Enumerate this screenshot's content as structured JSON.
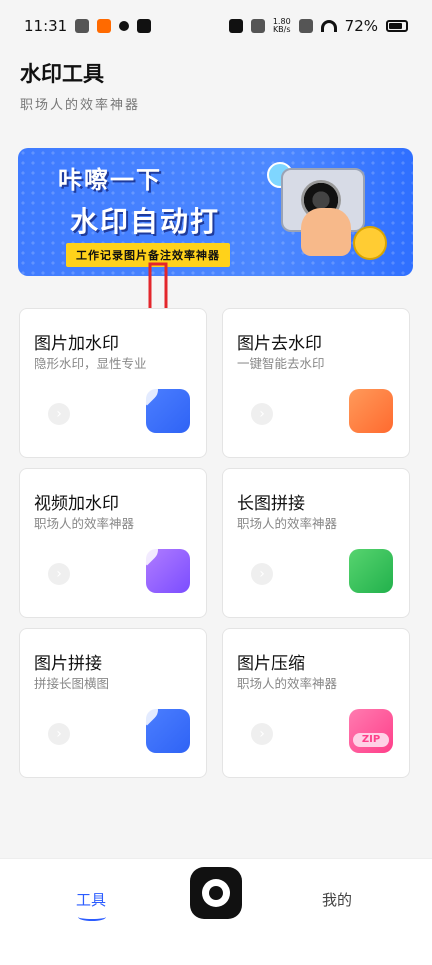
{
  "status_bar": {
    "time": "11:31",
    "net_speed_value": "1.80",
    "net_speed_unit": "KB/s",
    "battery_percent": "72%"
  },
  "header": {
    "title": "水印工具",
    "subtitle": "职场人的效率神器"
  },
  "banner": {
    "line1": "咔嚓一下",
    "line2": "水印自动打",
    "tag": "工作记录图片备注效率神器"
  },
  "cards": [
    {
      "title": "图片加水印",
      "subtitle": "隐形水印，显性专业",
      "icon": "image-add-icon",
      "accent": "#4b7eff"
    },
    {
      "title": "图片去水印",
      "subtitle": "一键智能去水印",
      "icon": "image-remove-icon",
      "accent": "#ff7a3d"
    },
    {
      "title": "视频加水印",
      "subtitle": "职场人的效率神器",
      "icon": "video-add-icon",
      "accent": "#8f5cff"
    },
    {
      "title": "长图拼接",
      "subtitle": "职场人的效率神器",
      "icon": "grid-join-icon",
      "accent": "#22b14c"
    },
    {
      "title": "图片拼接",
      "subtitle": "拼接长图横图",
      "icon": "image-join-icon",
      "accent": "#4b7eff"
    },
    {
      "title": "图片压缩",
      "subtitle": "职场人的效率神器",
      "icon": "zip-icon",
      "zip_label": "ZIP",
      "accent": "#ff3f8a"
    }
  ],
  "bottom_nav": {
    "tools_label": "工具",
    "mine_label": "我的",
    "active_color": "#2b5cff"
  }
}
